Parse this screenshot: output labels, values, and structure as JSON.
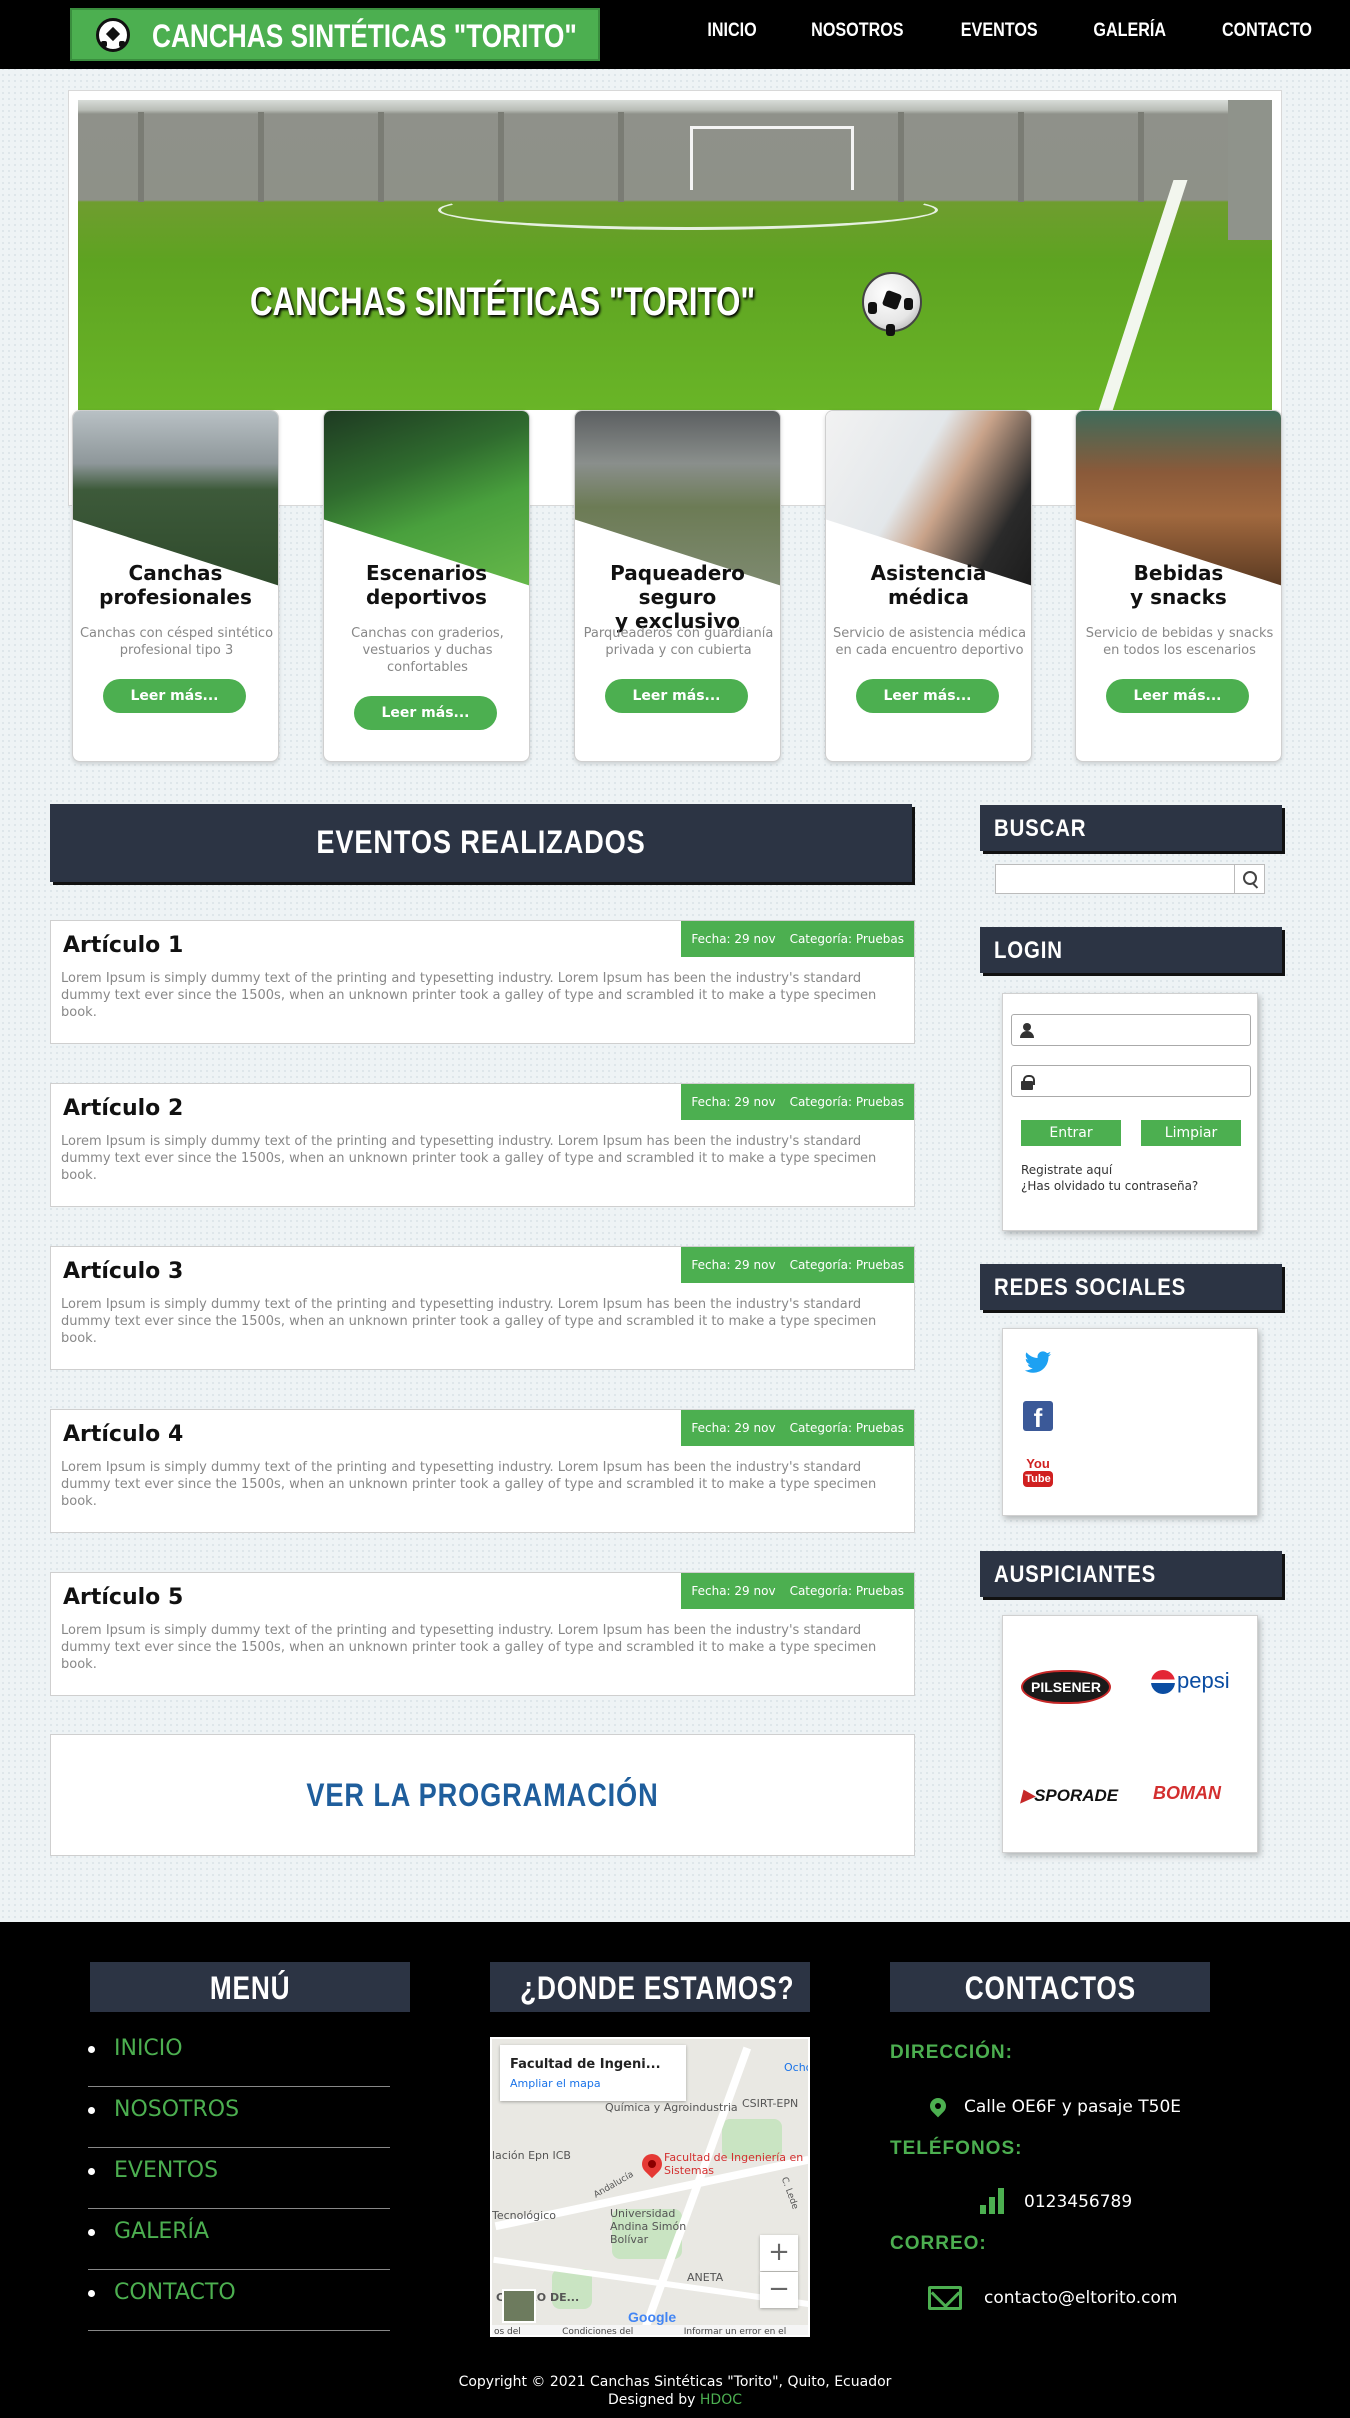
{
  "header": {
    "brand": "CANCHAS SINTÉTICAS \"TORITO\"",
    "nav": [
      "INICIO",
      "NOSOTROS",
      "EVENTOS",
      "GALERÍA",
      "CONTACTO"
    ]
  },
  "hero": {
    "title": "CANCHAS SINTÉTICAS \"TORITO\""
  },
  "features": [
    {
      "title": "Canchas\nprofesionales",
      "text": "Canchas con césped sintético profesional tipo 3",
      "button": "Leer más..."
    },
    {
      "title": "Escenarios\ndeportivos",
      "text": "Canchas con graderios, vestuarios y duchas confortables",
      "button": "Leer más..."
    },
    {
      "title": "Paqueadero seguro\ny exclusivo",
      "text": "Parqueaderos con guardianía privada y con cubierta",
      "button": "Leer más..."
    },
    {
      "title": "Asistencia\nmédica",
      "text": "Servicio de asistencia médica en cada encuentro deportivo",
      "button": "Leer más..."
    },
    {
      "title": "Bebidas\ny snacks",
      "text": "Servicio de bebidas y snacks en todos los escenarios",
      "button": "Leer más..."
    }
  ],
  "events": {
    "heading": "EVENTOS REALIZADOS",
    "articles": [
      {
        "title": "Artículo 1",
        "date": "Fecha: 29 nov",
        "category": "Categoría: Pruebas",
        "text": "Lorem Ipsum is simply dummy text of the printing and typesetting industry. Lorem Ipsum has been the industry's standard dummy text ever since the 1500s, when an unknown printer took a galley of type and scrambled it to make a type specimen book."
      },
      {
        "title": "Artículo 2",
        "date": "Fecha: 29 nov",
        "category": "Categoría: Pruebas",
        "text": "Lorem Ipsum is simply dummy text of the printing and typesetting industry. Lorem Ipsum has been the industry's standard dummy text ever since the 1500s, when an unknown printer took a galley of type and scrambled it to make a type specimen book."
      },
      {
        "title": "Artículo 3",
        "date": "Fecha: 29 nov",
        "category": "Categoría: Pruebas",
        "text": "Lorem Ipsum is simply dummy text of the printing and typesetting industry. Lorem Ipsum has been the industry's standard dummy text ever since the 1500s, when an unknown printer took a galley of type and scrambled it to make a type specimen book."
      },
      {
        "title": "Artículo 4",
        "date": "Fecha: 29 nov",
        "category": "Categoría: Pruebas",
        "text": "Lorem Ipsum is simply dummy text of the printing and typesetting industry. Lorem Ipsum has been the industry's standard dummy text ever since the 1500s, when an unknown printer took a galley of type and scrambled it to make a type specimen book."
      },
      {
        "title": "Artículo 5",
        "date": "Fecha: 29 nov",
        "category": "Categoría: Pruebas",
        "text": "Lorem Ipsum is simply dummy text of the printing and typesetting industry. Lorem Ipsum has been the industry's standard dummy text ever since the 1500s, when an unknown printer took a galley of type and scrambled it to make a type specimen book."
      }
    ],
    "program_link": "VER LA PROGRAMACIÓN"
  },
  "sidebar": {
    "search_heading": "BUSCAR",
    "search_value": "",
    "login_heading": "LOGIN",
    "user_value": "",
    "password_value": "",
    "enter_button": "Entrar",
    "clear_button": "Limpiar",
    "register_link": "Registrate aquí",
    "forgot_link": "¿Has olvidado tu contraseña?",
    "social_heading": "REDES SOCIALES",
    "social_icons": [
      "twitter-icon",
      "facebook-icon",
      "youtube-icon"
    ],
    "youtube_top": "You",
    "youtube_bottom": "Tube",
    "facebook_letter": "f",
    "sponsors_heading": "AUSPICIANTES",
    "sponsors": [
      "PILSENER",
      "pepsi",
      "SPORADE",
      "BOMAN"
    ]
  },
  "footer": {
    "menu_heading": "MENÚ",
    "menu": [
      "INICIO",
      "NOSOTROS",
      "EVENTOS",
      "GALERÍA",
      "CONTACTO"
    ],
    "location_heading": "¿DONDE ESTAMOS?",
    "map": {
      "place_title": "Facultad de Ingeni...",
      "enlarge_link": "Ampliar el mapa",
      "pin_label": "Facultad de Ingeniería en Sistemas",
      "labels": [
        "Química y Agroindustria",
        "CSIRT-EPN",
        "lación Epn ICB",
        "Tecnológico",
        "Universidad Andina Simón Bolívar",
        "ANETA",
        "CENTRO DE...",
        "Ocho",
        "Andalucía",
        "C. Lede"
      ],
      "footer_text": [
        "os del mapa",
        "Condiciones del Servicio",
        "Informar un error en el mapa"
      ],
      "google": "Google",
      "zoom_in": "+",
      "zoom_out": "−"
    },
    "contacts_heading": "CONTACTOS",
    "address_label": "DIRECCIÓN:",
    "address": "Calle OE6F y pasaje T50E",
    "phones_label": "TELÉFONOS:",
    "phone": "0123456789",
    "email_label": "CORREO:",
    "email": "contacto@eltorito.com",
    "copyright": "Copyright © 2021 Canchas Sintéticas \"Torito\", Quito, Ecuador",
    "designed_by": "Designed by ",
    "designer": "HDOC"
  },
  "colors": {
    "accent_green": "#4caf50",
    "dark_navy": "#2c3444",
    "link_blue": "#1f5e9c"
  }
}
